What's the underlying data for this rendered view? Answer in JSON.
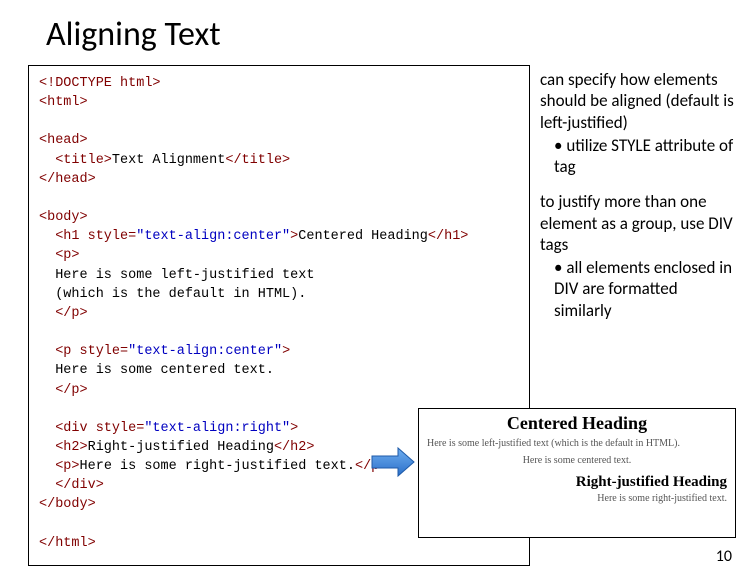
{
  "title": "Aligning Text",
  "code": {
    "l1a": "<!DOCTYPE html>",
    "l2a": "<html>",
    "l3a": "<head>",
    "l4a": "  <title>",
    "l4b": "Text Alignment",
    "l4c": "</title>",
    "l5a": "</head>",
    "l6a": "<body>",
    "l7a": "  <h1 style=",
    "l7b": "\"text-align:center\"",
    "l7c": ">",
    "l7d": "Centered Heading",
    "l7e": "</h1>",
    "l8a": "  <p>",
    "l9a": "  Here is some left-justified text",
    "l10a": "  (which is the default in HTML).",
    "l11a": "  </p>",
    "l12a": "  <p style=",
    "l12b": "\"text-align:center\"",
    "l12c": ">",
    "l13a": "  Here is some centered text.",
    "l14a": "  </p>",
    "l15a": "  <div style=",
    "l15b": "\"text-align:right\"",
    "l15c": ">",
    "l16a": "  <h2>",
    "l16b": "Right-justified Heading",
    "l16c": "</h2>",
    "l17a": "  <p>",
    "l17b": "Here is some right-justified text.",
    "l17c": "</p>",
    "l18a": "  </div>",
    "l19a": "</body>",
    "l20a": "</html>"
  },
  "right": {
    "p1": "can specify how elements should be aligned (default is left-justified)",
    "b1a": "utilize STYLE",
    "b1b": "attribute of tag",
    "p2": "to justify more than one element as a group, use DIV tags",
    "b2": "all elements enclosed in DIV are formatted similarly"
  },
  "preview": {
    "h1": "Centered Heading",
    "p1": "Here is some left-justified text (which is the default in HTML).",
    "p2": "Here is some centered text.",
    "h2": "Right-justified Heading",
    "p3": "Here is some right-justified text."
  },
  "pageNum": "10"
}
